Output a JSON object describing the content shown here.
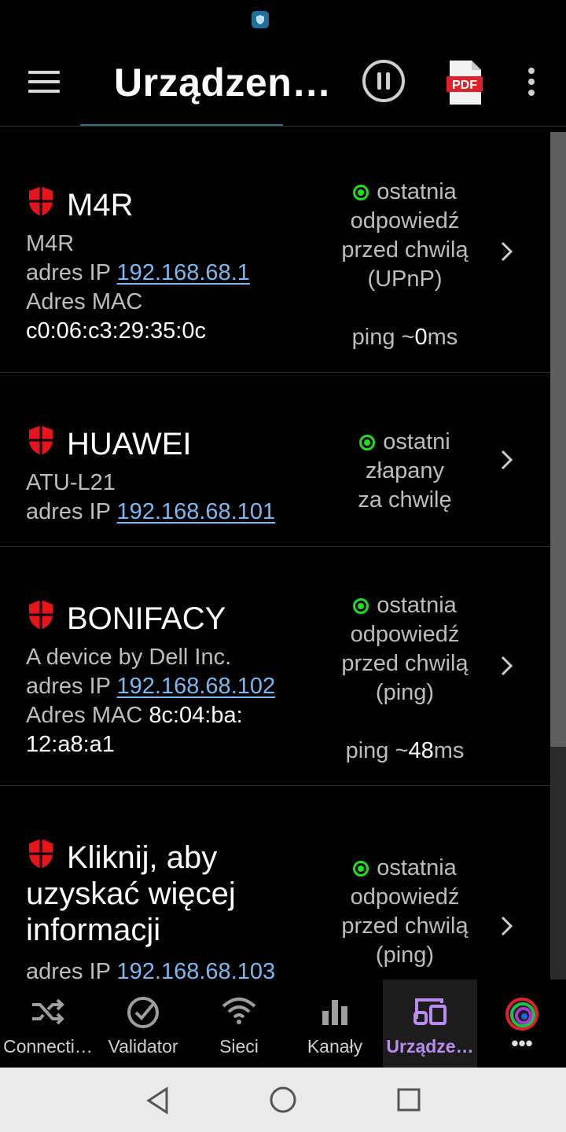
{
  "app": {
    "title": "Urządzen…",
    "pdf_label": "PDF"
  },
  "devices": [
    {
      "name": "M4R",
      "model": "M4R",
      "ip_label": "adres IP",
      "ip": "192.168.68.1",
      "mac_label": "Adres MAC",
      "mac": "c0:06:c3:29:35:0c",
      "status_lines": [
        "ostatnia",
        "odpowiedź",
        "przed chwilą",
        "(UPnP)"
      ],
      "ping_prefix": "ping ~",
      "ping_value": "0",
      "ping_unit": "ms"
    },
    {
      "name": "HUAWEI",
      "model": "ATU-L21",
      "ip_label": "adres IP",
      "ip": "192.168.68.101",
      "status_lines": [
        "ostatni",
        "złapany",
        "za chwilę"
      ]
    },
    {
      "name": "BONIFACY",
      "model": "A device by Dell Inc.",
      "ip_label": "adres IP",
      "ip": "192.168.68.102",
      "mac_label": "Adres MAC",
      "mac_part1": "8c:04:ba:",
      "mac_part2": "12:a8:a1",
      "status_lines": [
        "ostatnia",
        "odpowiedź",
        "przed chwilą",
        "(ping)"
      ],
      "ping_prefix": "ping ~",
      "ping_value": "48",
      "ping_unit": "ms"
    },
    {
      "name": "Kliknij, aby uzyskać więcej informacji",
      "ip_label": "adres IP",
      "ip": "192.168.68.103",
      "status_lines": [
        "ostatnia",
        "odpowiedź",
        "przed chwilą",
        "(ping)"
      ]
    }
  ],
  "nav": {
    "items": [
      {
        "label": "Connecti…",
        "icon": "shuffle-icon"
      },
      {
        "label": "Validator",
        "icon": "check-circle-icon"
      },
      {
        "label": "Sieci",
        "icon": "wifi-icon"
      },
      {
        "label": "Kanały",
        "icon": "bar-chart-icon"
      },
      {
        "label": "Urządze…",
        "icon": "devices-icon",
        "active": true
      },
      {
        "label": "•••",
        "icon": "color-ring-icon"
      }
    ]
  },
  "colors": {
    "accent": "#b98cf2",
    "link": "#7ab8f0",
    "online": "#1ee01e",
    "shield": "#e8141b"
  }
}
